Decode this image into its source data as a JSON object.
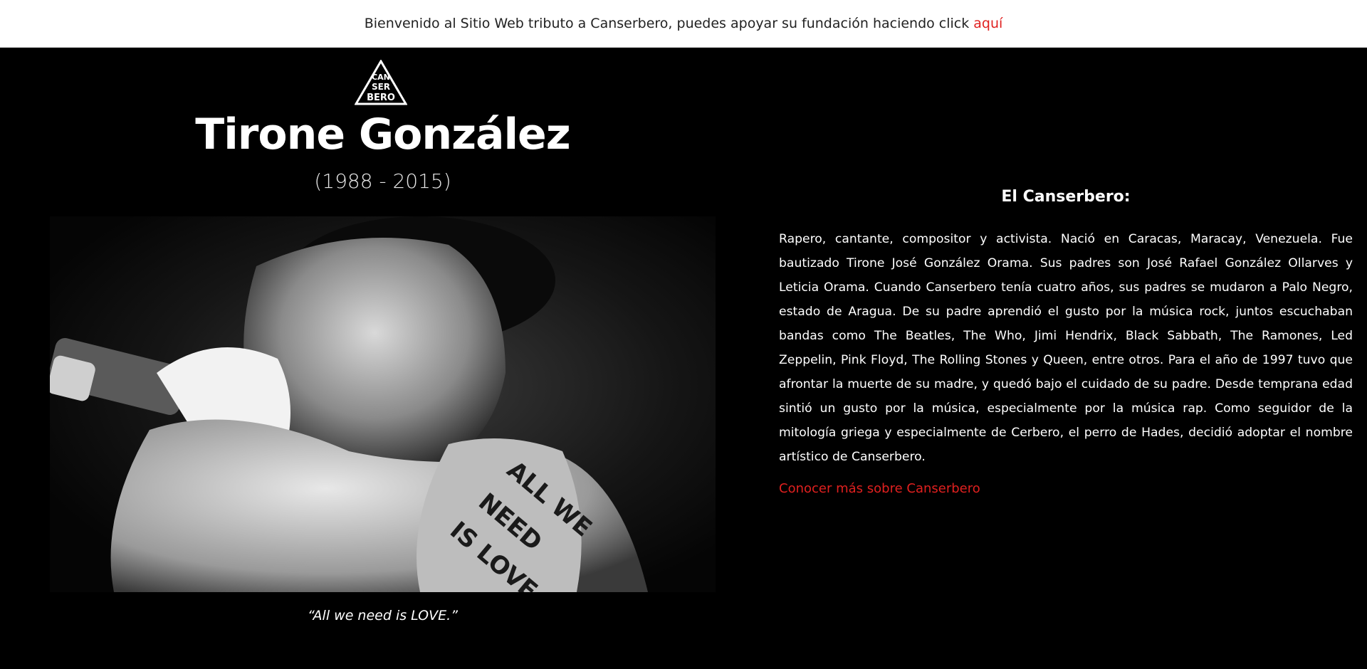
{
  "banner": {
    "text": "Bienvenido al Sitio Web tributo a Canserbero, puedes apoyar su fundación haciendo click",
    "link": "aquí"
  },
  "logo": {
    "alt": "CAN SER BERO"
  },
  "hero": {
    "name": "Tirone González",
    "years": "(1988 - 2015)",
    "photo_alt": "Canserbero cantando con micrófono, tatuaje 'All we need is love'",
    "quote": "“All we need is LOVE.”"
  },
  "bio": {
    "heading": "El Canserbero:",
    "paragraph": "Rapero, cantante, compositor y activista. Nació en Caracas, Maracay, Venezuela. Fue bautizado Tirone José González Orama. Sus padres son José Rafael González Ollarves y Leticia Orama. Cuando Canserbero tenía cuatro años, sus padres se mudaron a Palo Negro, estado de Aragua. De su padre aprendió el gusto por la música rock, juntos escuchaban bandas como The Beatles, The Who, Jimi Hendrix, Black Sabbath, The Ramones, Led Zeppelin, Pink Floyd, The Rolling Stones y Queen, entre otros. Para el año de 1997 tuvo que afrontar la muerte de su madre, y quedó bajo el cuidado de su padre. Desde temprana edad sintió un gusto por la música, especialmente por la música rap. Como seguidor de la mitología griega y especialmente de Cerbero, el perro de Hades, decidió adoptar el nombre artístico de Canserbero.",
    "more_link": "Conocer más sobre Canserbero"
  },
  "colors": {
    "accent": "#e0201f",
    "background": "#000000",
    "banner_bg": "#ffffff"
  }
}
